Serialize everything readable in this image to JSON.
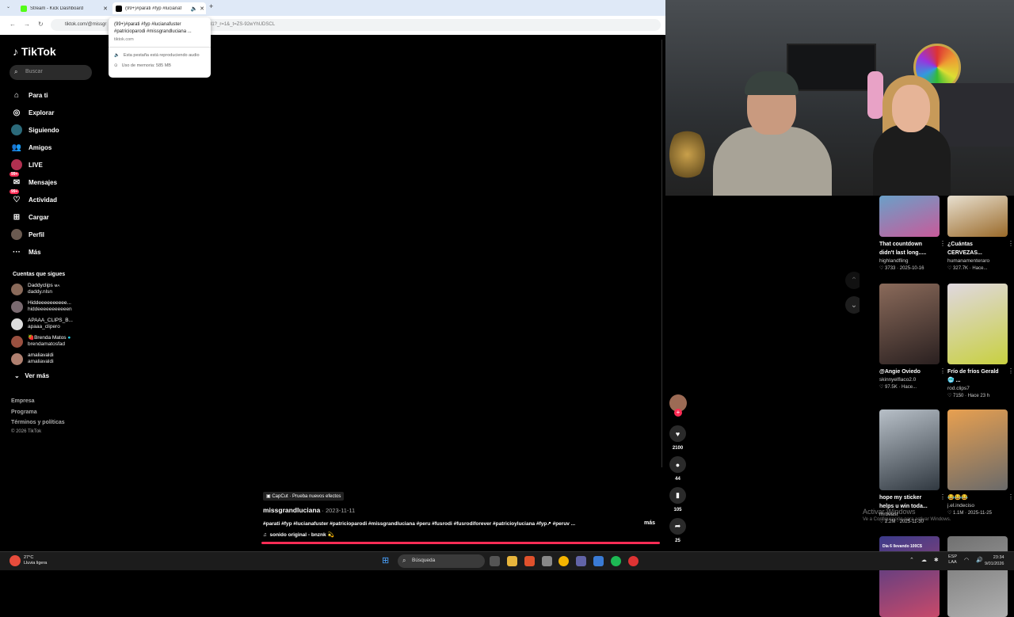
{
  "browser": {
    "tabs": [
      {
        "title": "Stream - Kick Dashboard",
        "favicon_color": "#53fc18"
      },
      {
        "title": "(99+)#parati #fyp #lucianaf",
        "favicon_color": "#000000"
      }
    ],
    "address": "tiktok.com/@missgr",
    "address_rest": "31?_r=1&_t=ZS-92wYhUDSCL",
    "hovercard": {
      "title": "(99+)#parati #fyp #lucianafuster #patricioparodi #missgrandluciana ...",
      "domain": "tiktok.com",
      "audio_note": "Esta pestaña está reproduciendo audio",
      "memory_note": "Uso de memoria: 585 MB"
    }
  },
  "tiktok": {
    "logo": "TikTok",
    "search_placeholder": "Buscar",
    "nav": [
      {
        "label": "Para ti",
        "icon": "home-icon"
      },
      {
        "label": "Explorar",
        "icon": "compass-icon"
      },
      {
        "label": "Siguiendo",
        "icon": "following-icon"
      },
      {
        "label": "Amigos",
        "icon": "friends-icon"
      },
      {
        "label": "LIVE",
        "icon": "live-icon"
      },
      {
        "label": "Mensajes",
        "icon": "messages-icon",
        "badge": "99+"
      },
      {
        "label": "Actividad",
        "icon": "activity-icon",
        "badge": "99+"
      },
      {
        "label": "Cargar",
        "icon": "upload-icon"
      },
      {
        "label": "Perfil",
        "icon": "profile-icon"
      },
      {
        "label": "Más",
        "icon": "more-icon"
      }
    ],
    "following_title": "Cuentas que sigues",
    "following": [
      {
        "name": "Daddyclips",
        "tag": "MA",
        "handle": "daddy.nlsn"
      },
      {
        "name": "Hiddeeeeeeeeee...",
        "handle": "hiddeeeeeeeeeeen"
      },
      {
        "name": "APAAA_CLIPS_B...",
        "handle": "apaaa_clipero"
      },
      {
        "name": "🍓Brenda Matos",
        "handle": "brendamatosfad"
      },
      {
        "name": "amaliavaldi",
        "handle": "amaliavaldi"
      }
    ],
    "see_more": "Ver más",
    "footer_links": [
      "Empresa",
      "Programa",
      "Términos y políticas"
    ],
    "copyright": "© 2026 TikTok"
  },
  "video": {
    "capcut": "CapCut · Prueba nuevos efectos",
    "author": "missgrandluciana",
    "date": " · 2023-11-11",
    "hashtags": "#parati #fyp #lucianafuster #patricioparodi #missgrandluciana #peru #fusrodi #fusrodiforever #patricioyluciana #fyp↗ #peruv ...",
    "more": "más",
    "sound": "sonido original - bnznk 💫",
    "progress": 1.0,
    "likes": "2100",
    "comments": "44",
    "saves": "105",
    "shares": "25"
  },
  "feed": [
    {
      "title": "That countdown didn't last long.....",
      "user": "highlandfling",
      "meta": "♡ 3733 · 2025-10-16",
      "colors": [
        "#6aa0c8",
        "#c85a9a"
      ]
    },
    {
      "title": "¿Cuántas CERVEZAS...",
      "user": "humanamenteraro",
      "meta": "♡ 327.7K · Hace...",
      "colors": [
        "#e8e0d0",
        "#9a6a2a"
      ]
    },
    {
      "title": "@Angie Oviedo",
      "user": "skinnyelflaco2.0",
      "meta": "♡ 97.5K · Hace...",
      "colors": [
        "#8a6a5a",
        "#2a2020"
      ]
    },
    {
      "title": "Frío de fríos Gerald 🥶 ...",
      "user": "rod.clips7",
      "meta": "♡ 7150 · Hace 23 h",
      "colors": [
        "#e0d8e0",
        "#c8d040"
      ]
    },
    {
      "title": "hope my sticker helps u win toda...",
      "user": "mrbeast",
      "meta": "♡ 2.2M · 2025-11-30",
      "colors": [
        "#b8c0c8",
        "#303840"
      ]
    },
    {
      "title": "😂😂😂",
      "user": "j.el.indeciso",
      "meta": "♡ 1.1M · 2025-11-25",
      "colors": [
        "#e8a050",
        "#6a6a6a"
      ]
    },
    {
      "title": "",
      "user": "",
      "meta": "",
      "colors": [
        "#3a3a8a",
        "#c84a6a"
      ],
      "label": "Día 6 llevando 100C$"
    },
    {
      "title": "",
      "user": "",
      "meta": "",
      "colors": [
        "#707070",
        "#b0b0b0"
      ]
    }
  ],
  "watermark": {
    "title": "Activar Windows",
    "sub": "Ve a Configuración para activar Windows."
  },
  "taskbar": {
    "temp": "27°C",
    "weather": "Lluvia ligera",
    "search_placeholder": "Búsqueda",
    "lang1": "ESP",
    "lang2": "LAA",
    "time": "23:34",
    "date": "9/01/2026"
  }
}
